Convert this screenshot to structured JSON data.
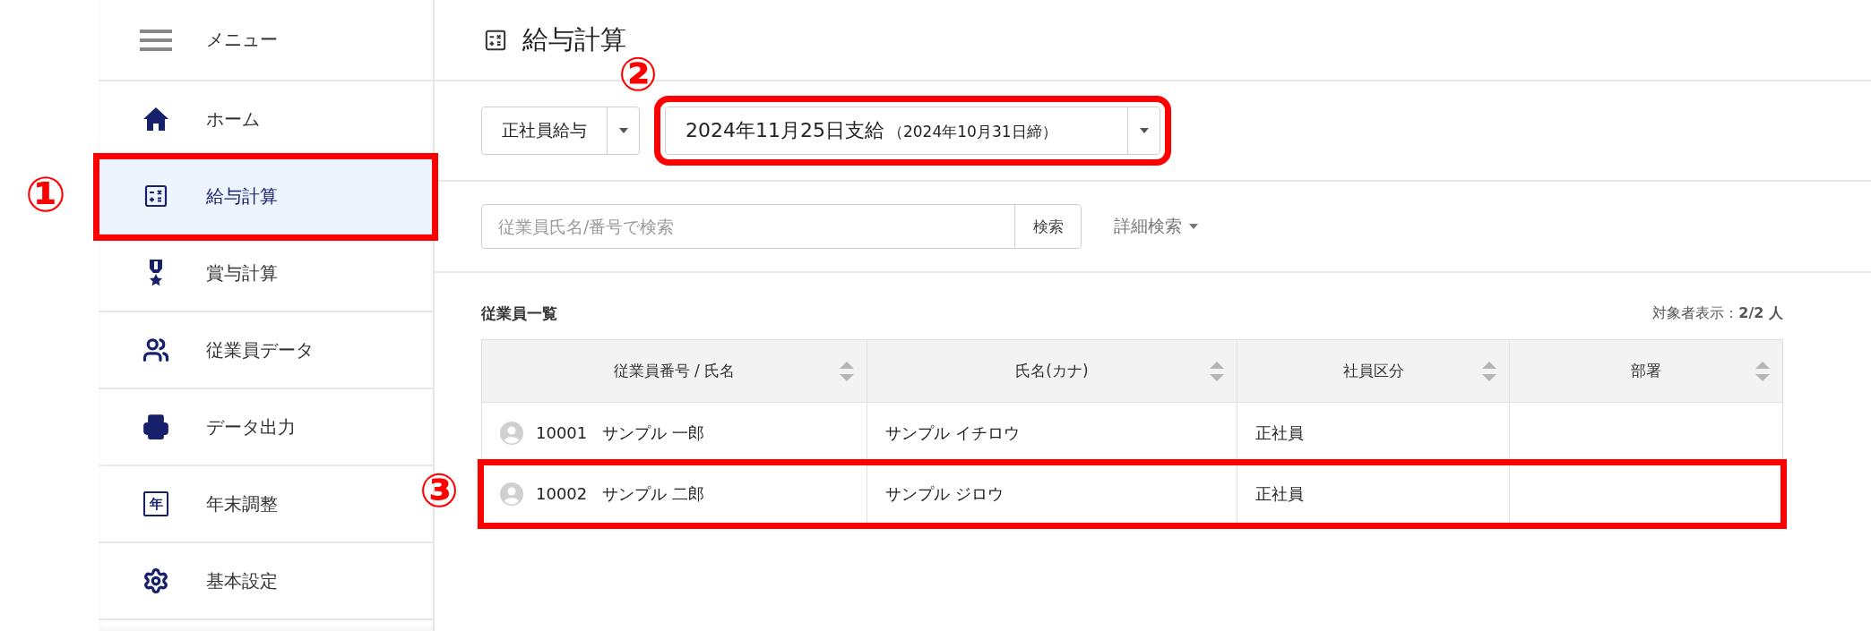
{
  "sidebar": {
    "menu_label": "メニュー",
    "items": [
      {
        "label": "ホーム",
        "selected": false
      },
      {
        "label": "給与計算",
        "selected": true,
        "annotation": "①"
      },
      {
        "label": "賞与計算",
        "selected": false
      },
      {
        "label": "従業員データ",
        "selected": false
      },
      {
        "label": "データ出力",
        "selected": false
      },
      {
        "label": "年末調整",
        "icon_glyph": "年",
        "selected": false
      },
      {
        "label": "基本設定",
        "selected": false
      }
    ]
  },
  "page": {
    "title": "給与計算"
  },
  "toolbar": {
    "payroll_type": "正社員給与",
    "pay_date": {
      "main": "2024年11月25日支給",
      "sub": "（2024年10月31日締）",
      "annotation": "②"
    }
  },
  "search": {
    "placeholder": "従業員氏名/番号で検索",
    "button": "検索",
    "advanced": "詳細検索"
  },
  "list": {
    "title": "従業員一覧",
    "count_label": "対象者表示：",
    "count": "2/2 人"
  },
  "table": {
    "columns": [
      "従業員番号 / 氏名",
      "氏名(カナ)",
      "社員区分",
      "部署"
    ],
    "rows": [
      {
        "number": "10001",
        "name": "サンプル 一郎",
        "kana": "サンプル イチロウ",
        "type": "正社員"
      },
      {
        "number": "10002",
        "name": "サンプル 二郎",
        "kana": "サンプル ジロウ",
        "type": "正社員",
        "annotation": "③"
      }
    ]
  }
}
